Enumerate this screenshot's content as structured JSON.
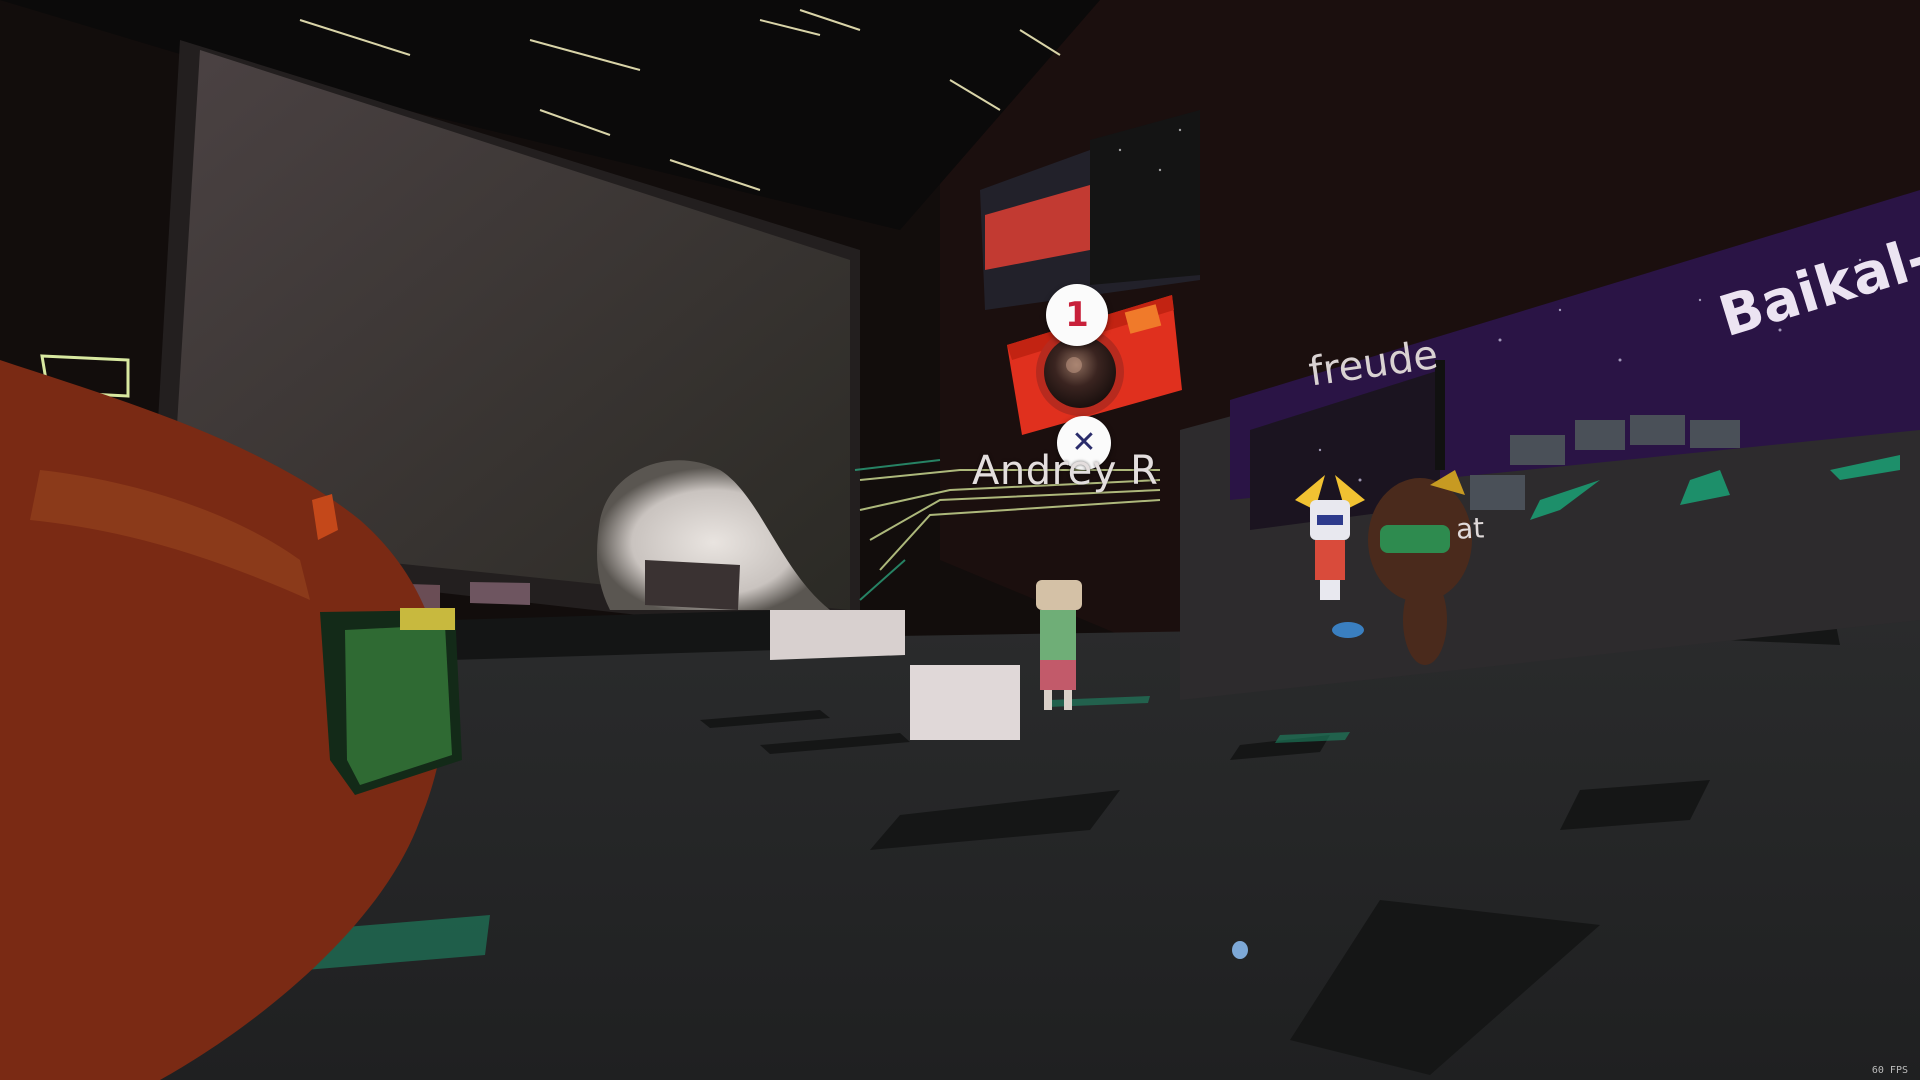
{
  "scene": {
    "presenter_name": "Andrey R",
    "sign_left_label": "Baikal-",
    "sign_middle_label": "freude",
    "partial_name_label": "at"
  },
  "camera_tool": {
    "photo_count": "1",
    "close_symbol": "✕",
    "icon": "camera-icon",
    "close_icon": "close-icon"
  },
  "status": {
    "fps": "60 FPS"
  },
  "colors": {
    "accent_green": "#1d8f6a",
    "camera_red": "#e0301e",
    "sky_purple": "#2a1445"
  }
}
